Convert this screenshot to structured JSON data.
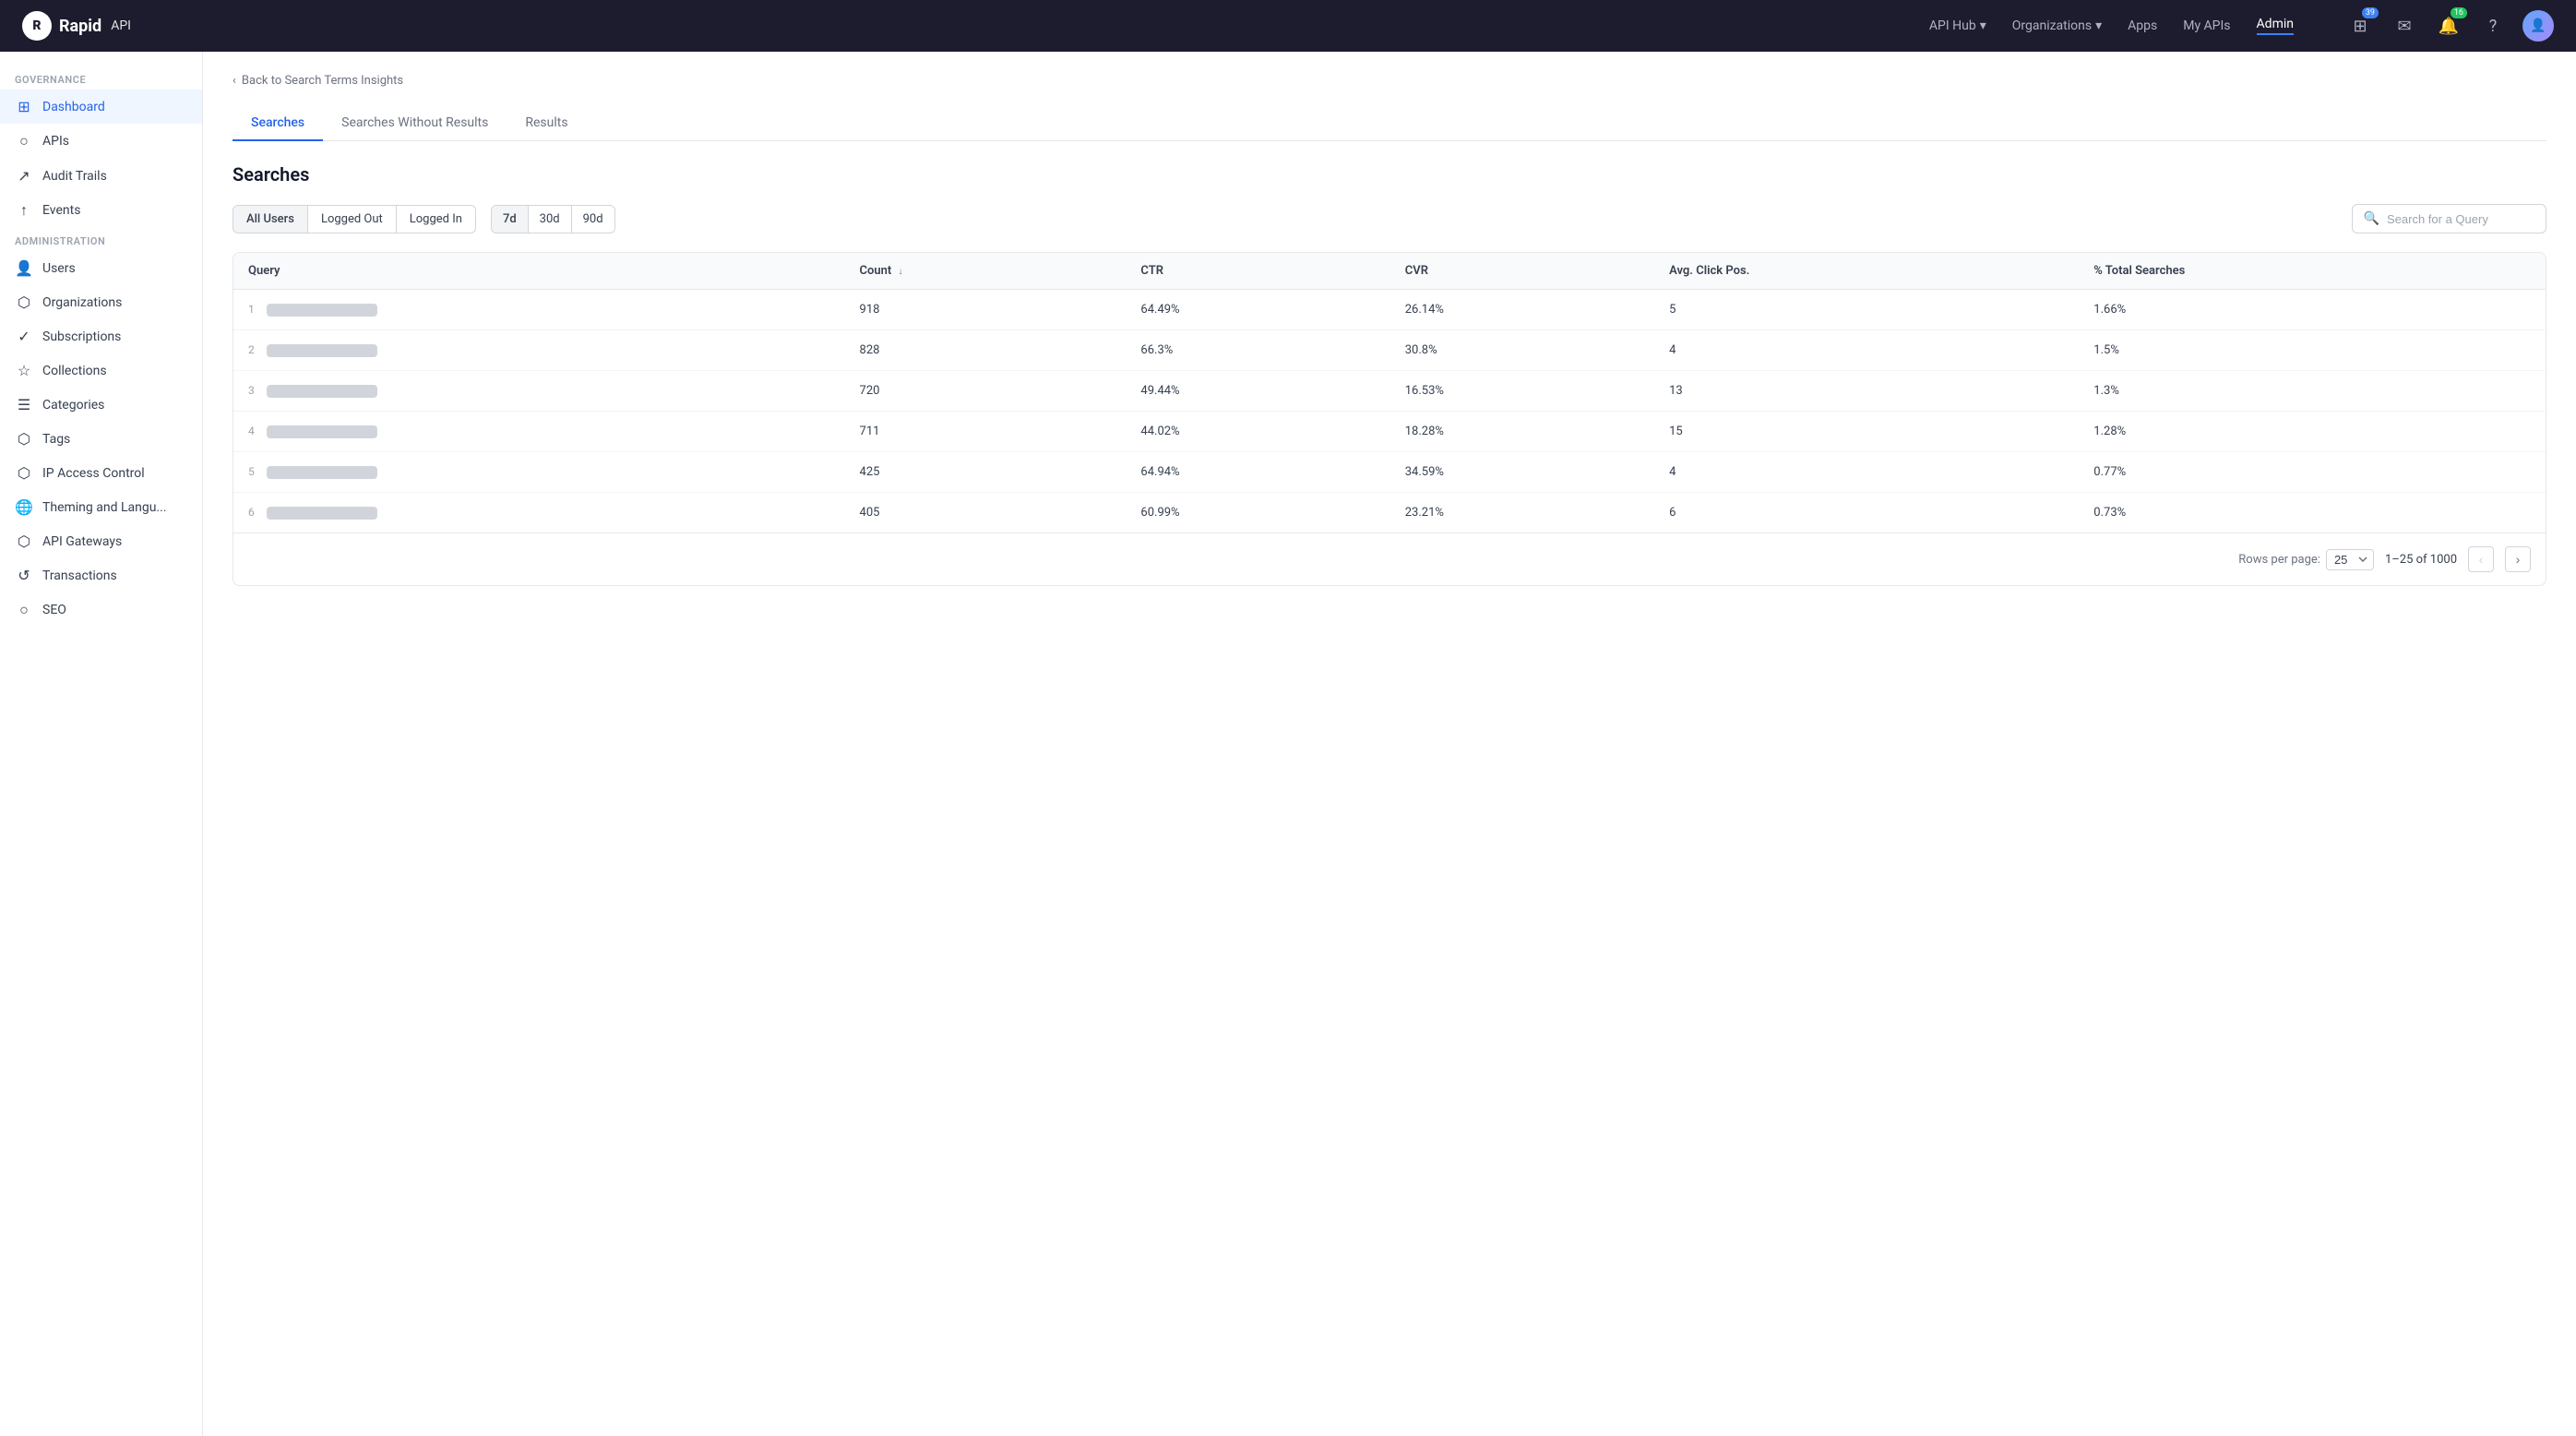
{
  "topnav": {
    "logo_text": "Rapid",
    "logo_api": "API",
    "nav_items": [
      {
        "label": "API Hub",
        "has_arrow": true
      },
      {
        "label": "Organizations",
        "has_arrow": true
      },
      {
        "label": "Apps"
      },
      {
        "label": "My APIs"
      },
      {
        "label": "Admin",
        "active": true
      }
    ],
    "notification_badge": "39",
    "bell_badge": "16"
  },
  "sidebar": {
    "governance_label": "Governance",
    "governance_items": [
      {
        "label": "Dashboard",
        "icon": "⊞",
        "active": true
      },
      {
        "label": "APIs",
        "icon": "○"
      },
      {
        "label": "Audit Trails",
        "icon": "↗"
      },
      {
        "label": "Events",
        "icon": "↑"
      }
    ],
    "admin_label": "Administration",
    "admin_items": [
      {
        "label": "Users",
        "icon": "👤"
      },
      {
        "label": "Organizations",
        "icon": "⬡"
      },
      {
        "label": "Subscriptions",
        "icon": "✓"
      },
      {
        "label": "Collections",
        "icon": "☆"
      },
      {
        "label": "Categories",
        "icon": "☰"
      },
      {
        "label": "Tags",
        "icon": "⬡"
      },
      {
        "label": "IP Access Control",
        "icon": "⬡"
      },
      {
        "label": "Theming and Langu...",
        "icon": "🌐"
      },
      {
        "label": "API Gateways",
        "icon": "⬡"
      },
      {
        "label": "Transactions",
        "icon": "↺"
      },
      {
        "label": "SEO",
        "icon": "○"
      }
    ]
  },
  "breadcrumb": {
    "text": "Back to Search Terms Insights"
  },
  "tabs": [
    {
      "label": "Searches",
      "active": true
    },
    {
      "label": "Searches Without Results"
    },
    {
      "label": "Results"
    }
  ],
  "page": {
    "title": "Searches"
  },
  "filters": {
    "user_buttons": [
      {
        "label": "All Users"
      },
      {
        "label": "Logged Out"
      },
      {
        "label": "Logged In"
      }
    ],
    "day_buttons": [
      {
        "label": "7d",
        "active": true
      },
      {
        "label": "30d"
      },
      {
        "label": "90d"
      }
    ],
    "search_placeholder": "Search for a Query"
  },
  "table": {
    "columns": [
      {
        "label": "Query"
      },
      {
        "label": "Count",
        "sort": true
      },
      {
        "label": "CTR"
      },
      {
        "label": "CVR"
      },
      {
        "label": "Avg. Click Pos."
      },
      {
        "label": "% Total Searches"
      }
    ],
    "rows": [
      {
        "num": "1",
        "query_blurred": true,
        "count": "918",
        "ctr": "64.49%",
        "cvr": "26.14%",
        "avg_click_pos": "5",
        "pct_total": "1.66%"
      },
      {
        "num": "2",
        "query_blurred": true,
        "count": "828",
        "ctr": "66.3%",
        "cvr": "30.8%",
        "avg_click_pos": "4",
        "pct_total": "1.5%"
      },
      {
        "num": "3",
        "query_blurred": true,
        "count": "720",
        "ctr": "49.44%",
        "cvr": "16.53%",
        "avg_click_pos": "13",
        "pct_total": "1.3%"
      },
      {
        "num": "4",
        "query_blurred": true,
        "count": "711",
        "ctr": "44.02%",
        "cvr": "18.28%",
        "avg_click_pos": "15",
        "pct_total": "1.28%"
      },
      {
        "num": "5",
        "query_blurred": true,
        "count": "425",
        "ctr": "64.94%",
        "cvr": "34.59%",
        "avg_click_pos": "4",
        "pct_total": "0.77%"
      },
      {
        "num": "6",
        "query_blurred": true,
        "count": "405",
        "ctr": "60.99%",
        "cvr": "23.21%",
        "avg_click_pos": "6",
        "pct_total": "0.73%"
      }
    ]
  },
  "pagination": {
    "rows_per_page_label": "Rows per page:",
    "rows_per_page_value": "25",
    "page_info": "1–25 of 1000"
  }
}
